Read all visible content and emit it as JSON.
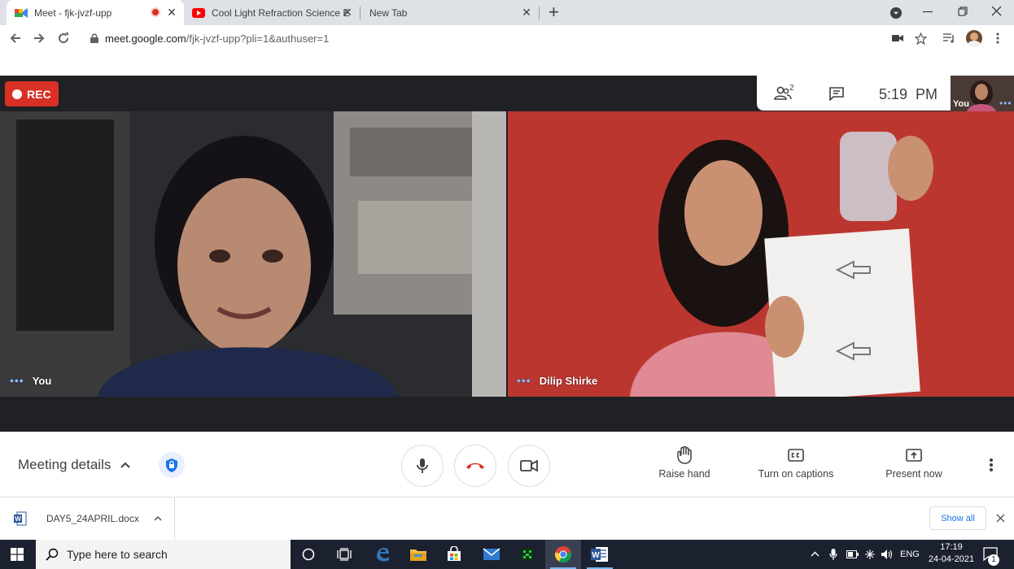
{
  "browser": {
    "tabs": [
      {
        "label": "Meet - fjk-jvzf-upp",
        "icon": "google-meet-icon",
        "recording": true,
        "active": true
      },
      {
        "label": "Cool Light Refraction Science Exp",
        "icon": "youtube-icon",
        "active": false
      },
      {
        "label": "New Tab",
        "active": false
      }
    ],
    "new_tab_symbol": "+",
    "close_symbol": "✕",
    "url_host": "meet.google.com",
    "url_path": "/fjk-jvzf-upp?pli=1&authuser=1"
  },
  "meet": {
    "rec_label": "REC",
    "participant_count": "2",
    "time": "5:19  PM",
    "self_thumb_label": "You",
    "tiles": [
      {
        "name": "You"
      },
      {
        "name": "Dilip Shirke"
      }
    ],
    "controls": {
      "meeting_details_label": "Meeting details",
      "raise_hand_label": "Raise hand",
      "captions_label": "Turn on captions",
      "present_label": "Present now"
    }
  },
  "downloads": {
    "file_name": "DAY5_24APRIL.docx",
    "show_all_label": "Show all"
  },
  "taskbar": {
    "search_placeholder": "Type here to search",
    "language": "ENG",
    "time": "17:19",
    "date": "24-04-2021",
    "notification_count": "1"
  },
  "colors": {
    "rec_red": "#d93025",
    "meet_dark": "#202124",
    "name_dots": "#8ab4f8",
    "hangup_red": "#d93025",
    "taskbar": "#1c2130"
  }
}
